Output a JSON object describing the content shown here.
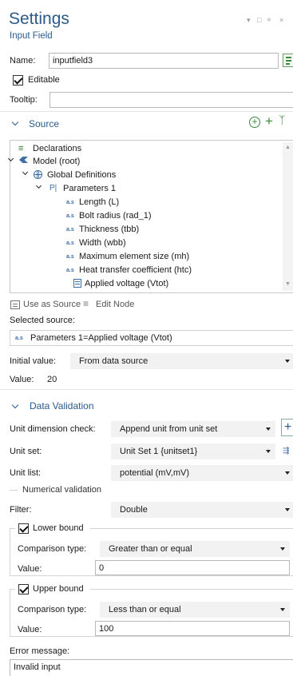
{
  "header": {
    "title": "Settings",
    "subtitle": "Input Field",
    "window_controls": "▾ □ ᵠ ×"
  },
  "name": {
    "label": "Name:",
    "value": "inputfield3"
  },
  "editable": {
    "label": "Editable",
    "checked": true
  },
  "tooltip": {
    "label": "Tooltip:",
    "value": ""
  },
  "source": {
    "title": "Source",
    "tree": [
      {
        "label": "Declarations",
        "icon": "declarations-icon"
      },
      {
        "label": "Model (root)",
        "icon": "model-icon"
      },
      {
        "label": "Global Definitions",
        "icon": "globe-icon"
      },
      {
        "label": "Parameters 1",
        "icon": "parameters-icon",
        "icon_text": "P|"
      },
      {
        "label": "Length (L)",
        "icon": "parameter-icon",
        "icon_text": "a.s"
      },
      {
        "label": "Bolt radius (rad_1)",
        "icon": "parameter-icon",
        "icon_text": "a.s"
      },
      {
        "label": "Thickness (tbb)",
        "icon": "parameter-icon",
        "icon_text": "a.s"
      },
      {
        "label": "Width (wbb)",
        "icon": "parameter-icon",
        "icon_text": "a.s"
      },
      {
        "label": "Maximum element size (mh)",
        "icon": "parameter-icon",
        "icon_text": "a.s"
      },
      {
        "label": "Heat transfer coefficient (htc)",
        "icon": "parameter-icon",
        "icon_text": "a.s"
      },
      {
        "label": "Applied voltage (Vtot)",
        "icon": "parameter-table-icon"
      }
    ],
    "use_as_source": "Use as Source",
    "edit_node": "Edit Node",
    "selected_label": "Selected source:",
    "selected_icon_text": "a.s",
    "selected_value": "Parameters 1=Applied voltage (Vtot)",
    "initial_value_label": "Initial value:",
    "initial_value": "From data source",
    "value_label": "Value:",
    "value": "20"
  },
  "validation": {
    "title": "Data Validation",
    "unit_dim_label": "Unit dimension check:",
    "unit_dim_value": "Append unit from unit set",
    "unit_set_label": "Unit set:",
    "unit_set_value": "Unit Set 1 {unitset1}",
    "unit_list_label": "Unit list:",
    "unit_list_value": "potential (mV,mV)",
    "numerical_label": "Numerical validation",
    "filter_label": "Filter:",
    "filter_value": "Double",
    "lower": {
      "label": "Lower bound",
      "checked": true,
      "comparison_label": "Comparison type:",
      "comparison_value": "Greater than or equal",
      "value_label": "Value:",
      "value": "0"
    },
    "upper": {
      "label": "Upper bound",
      "checked": true,
      "comparison_label": "Comparison type:",
      "comparison_value": "Less than or equal",
      "value_label": "Value:",
      "value": "100"
    },
    "error_label": "Error message:",
    "error_value": "Invalid input"
  },
  "colors": {
    "accent": "#2b5a8a",
    "green": "#3a8a3a",
    "dropdown_bg": "#f2f2f2"
  }
}
